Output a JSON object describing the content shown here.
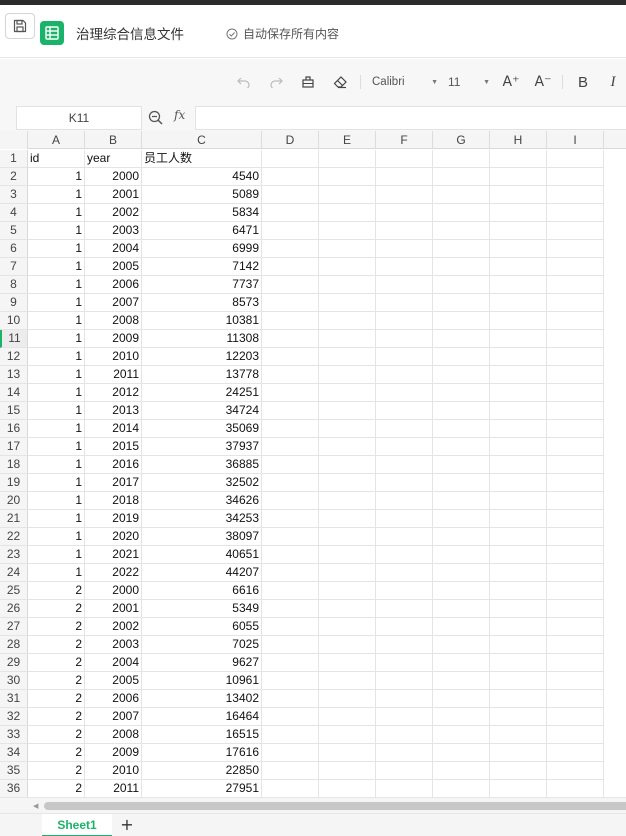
{
  "app": {
    "doc_title": "治理综合信息文件",
    "autosave_text": "自动保存所有内容"
  },
  "toolbar": {
    "font_name": "Calibri",
    "font_size": "11",
    "bold_label": "B",
    "italic_label": "I",
    "font_grow_label": "A⁺",
    "font_shrink_label": "A⁻"
  },
  "formula_bar": {
    "name_box": "K11",
    "fx_label": "fx",
    "value": ""
  },
  "grid": {
    "columns": [
      "A",
      "B",
      "C",
      "D",
      "E",
      "F",
      "G",
      "H",
      "I"
    ],
    "active_row": "11",
    "rows": [
      {
        "n": "1",
        "a": "id",
        "b": "year",
        "c": "员工人数"
      },
      {
        "n": "2",
        "a": "1",
        "b": "2000",
        "c": "4540"
      },
      {
        "n": "3",
        "a": "1",
        "b": "2001",
        "c": "5089"
      },
      {
        "n": "4",
        "a": "1",
        "b": "2002",
        "c": "5834"
      },
      {
        "n": "5",
        "a": "1",
        "b": "2003",
        "c": "6471"
      },
      {
        "n": "6",
        "a": "1",
        "b": "2004",
        "c": "6999"
      },
      {
        "n": "7",
        "a": "1",
        "b": "2005",
        "c": "7142"
      },
      {
        "n": "8",
        "a": "1",
        "b": "2006",
        "c": "7737"
      },
      {
        "n": "9",
        "a": "1",
        "b": "2007",
        "c": "8573"
      },
      {
        "n": "10",
        "a": "1",
        "b": "2008",
        "c": "10381"
      },
      {
        "n": "11",
        "a": "1",
        "b": "2009",
        "c": "11308"
      },
      {
        "n": "12",
        "a": "1",
        "b": "2010",
        "c": "12203"
      },
      {
        "n": "13",
        "a": "1",
        "b": "2011",
        "c": "13778"
      },
      {
        "n": "14",
        "a": "1",
        "b": "2012",
        "c": "24251"
      },
      {
        "n": "15",
        "a": "1",
        "b": "2013",
        "c": "34724"
      },
      {
        "n": "16",
        "a": "1",
        "b": "2014",
        "c": "35069"
      },
      {
        "n": "17",
        "a": "1",
        "b": "2015",
        "c": "37937"
      },
      {
        "n": "18",
        "a": "1",
        "b": "2016",
        "c": "36885"
      },
      {
        "n": "19",
        "a": "1",
        "b": "2017",
        "c": "32502"
      },
      {
        "n": "20",
        "a": "1",
        "b": "2018",
        "c": "34626"
      },
      {
        "n": "21",
        "a": "1",
        "b": "2019",
        "c": "34253"
      },
      {
        "n": "22",
        "a": "1",
        "b": "2020",
        "c": "38097"
      },
      {
        "n": "23",
        "a": "1",
        "b": "2021",
        "c": "40651"
      },
      {
        "n": "24",
        "a": "1",
        "b": "2022",
        "c": "44207"
      },
      {
        "n": "25",
        "a": "2",
        "b": "2000",
        "c": "6616"
      },
      {
        "n": "26",
        "a": "2",
        "b": "2001",
        "c": "5349"
      },
      {
        "n": "27",
        "a": "2",
        "b": "2002",
        "c": "6055"
      },
      {
        "n": "28",
        "a": "2",
        "b": "2003",
        "c": "7025"
      },
      {
        "n": "29",
        "a": "2",
        "b": "2004",
        "c": "9627"
      },
      {
        "n": "30",
        "a": "2",
        "b": "2005",
        "c": "10961"
      },
      {
        "n": "31",
        "a": "2",
        "b": "2006",
        "c": "13402"
      },
      {
        "n": "32",
        "a": "2",
        "b": "2007",
        "c": "16464"
      },
      {
        "n": "33",
        "a": "2",
        "b": "2008",
        "c": "16515"
      },
      {
        "n": "34",
        "a": "2",
        "b": "2009",
        "c": "17616"
      },
      {
        "n": "35",
        "a": "2",
        "b": "2010",
        "c": "22850"
      },
      {
        "n": "36",
        "a": "2",
        "b": "2011",
        "c": "27951"
      }
    ]
  },
  "sheets": {
    "active": "Sheet1",
    "add_label": "+"
  },
  "icons": {
    "save": "save-icon",
    "app": "spreadsheet-app-icon",
    "autosave": "check-circle-icon",
    "undo": "undo-icon",
    "redo": "redo-icon",
    "format_painter": "format-painter-icon",
    "eraser": "eraser-icon",
    "zoom": "zoom-icon"
  },
  "colors": {
    "accent": "#1bb369"
  }
}
